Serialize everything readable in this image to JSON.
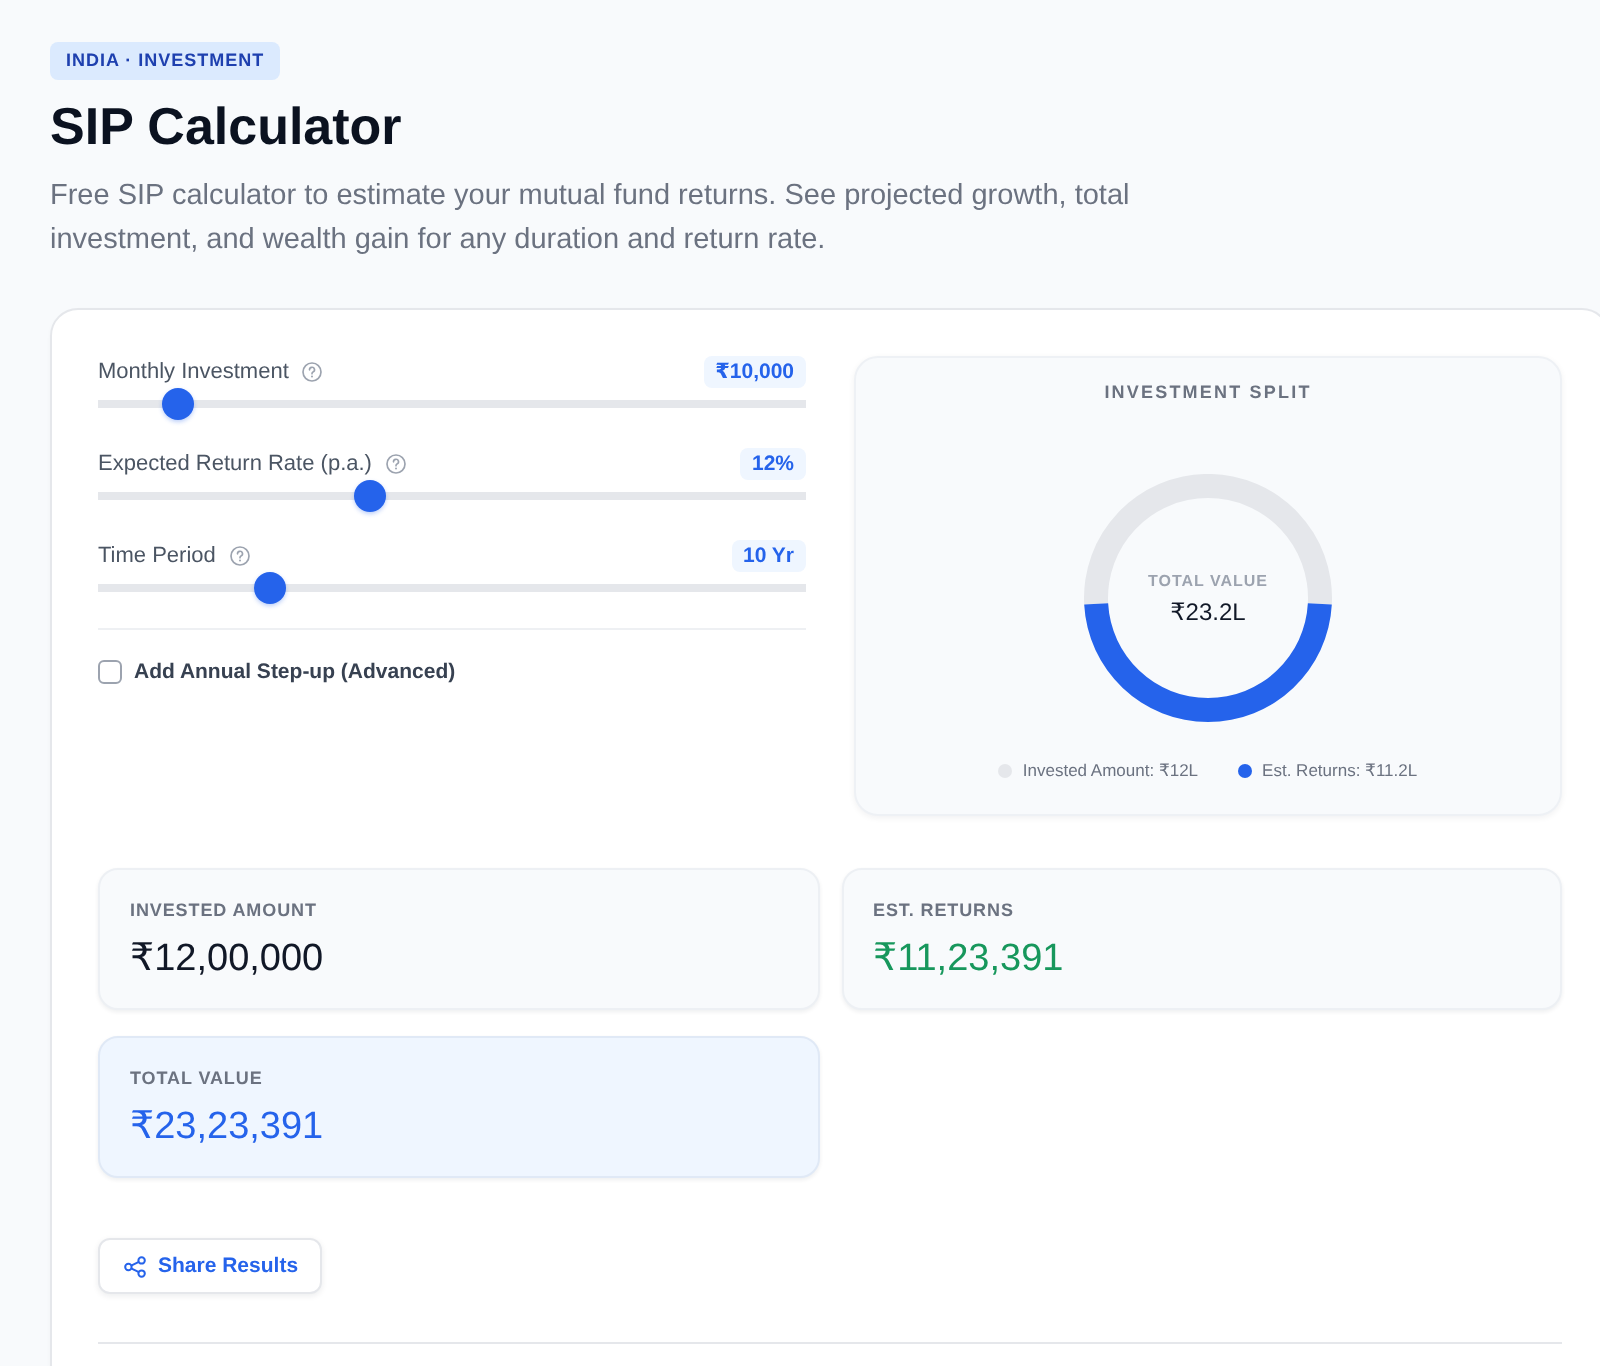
{
  "badge": "INDIA · INVESTMENT",
  "title": "SIP Calculator",
  "description": "Free SIP calculator to estimate your mutual fund returns. See projected growth, total investment, and wealth gain for any duration and return rate.",
  "inputs": [
    {
      "label": "Monthly Investment",
      "value": "₹10,000",
      "level": 0.095
    },
    {
      "label": "Expected Return Rate (p.a.)",
      "value": "12%",
      "level": 0.379
    },
    {
      "label": "Time Period",
      "value": "10 Yr",
      "level": 0.231
    }
  ],
  "step_up": {
    "label": "Add Annual Step-up (Advanced)",
    "checked": false
  },
  "split": {
    "center_label": "TOTAL VALUE",
    "center_value": "₹23.2L",
    "chart_data": {
      "type": "donut",
      "title": "INVESTMENT SPLIT",
      "values": [
        51.7,
        48.3
      ]
    },
    "legend": [
      {
        "label": "Invested Amount: ₹12L",
        "color": "#e5e7eb"
      },
      {
        "label": "Est. Returns: ₹11.2L",
        "color": "#2563eb"
      }
    ]
  },
  "results": [
    {
      "kind": "plain",
      "label": "INVESTED AMOUNT",
      "value": "₹12,00,000"
    },
    {
      "kind": "gain",
      "label": "EST. RETURNS",
      "value": "₹11,23,391"
    },
    {
      "kind": "total",
      "label": "TOTAL VALUE",
      "value": "₹23,23,391"
    }
  ],
  "share_button": {
    "label": "Share Results"
  }
}
